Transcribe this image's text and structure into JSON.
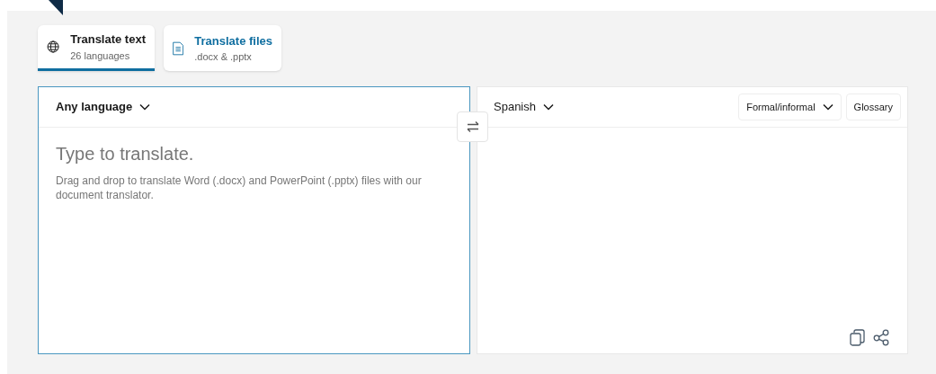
{
  "tabs": [
    {
      "kind": "text",
      "title": "Translate text",
      "subtitle": "26 languages",
      "selected": true
    },
    {
      "kind": "files",
      "title": "Translate files",
      "subtitle": ".docx & .pptx",
      "selected": false
    }
  ],
  "source": {
    "language": "Any language",
    "placeholder": "Type to translate.",
    "hint": "Drag and drop to translate Word (.docx) and PowerPoint (.pptx) files with our document translator."
  },
  "target": {
    "language": "Spanish",
    "formality": "Formal/informal",
    "glossary": "Glossary"
  }
}
